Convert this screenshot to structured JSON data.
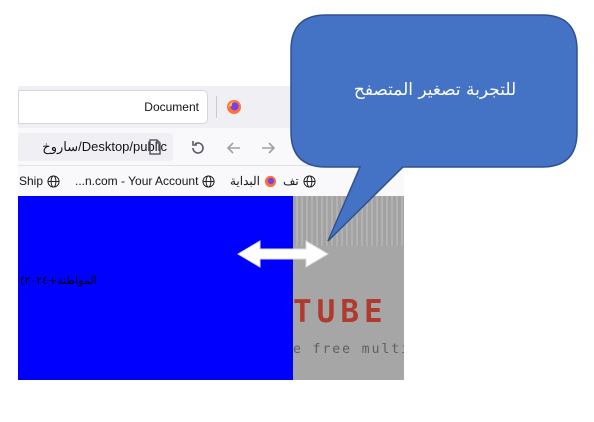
{
  "browser": {
    "tab_title": "Document",
    "url_text": "ساروخ/Desktop/public",
    "bookmarks": [
      "Ship",
      "...n.com - Your Account",
      "البداية",
      "تف"
    ]
  },
  "page": {
    "text": "(المواطنة+٢٠٢٤",
    "yt_text": "TUBE V",
    "yt_sub": "e free multi-p"
  },
  "callout": {
    "text": "للتجربة تصغير المتصفح"
  },
  "colors": {
    "page_blue": "#0000ff",
    "callout_fill": "#4472c4",
    "callout_border": "#2f528f",
    "yt_red": "#b03a2e"
  }
}
